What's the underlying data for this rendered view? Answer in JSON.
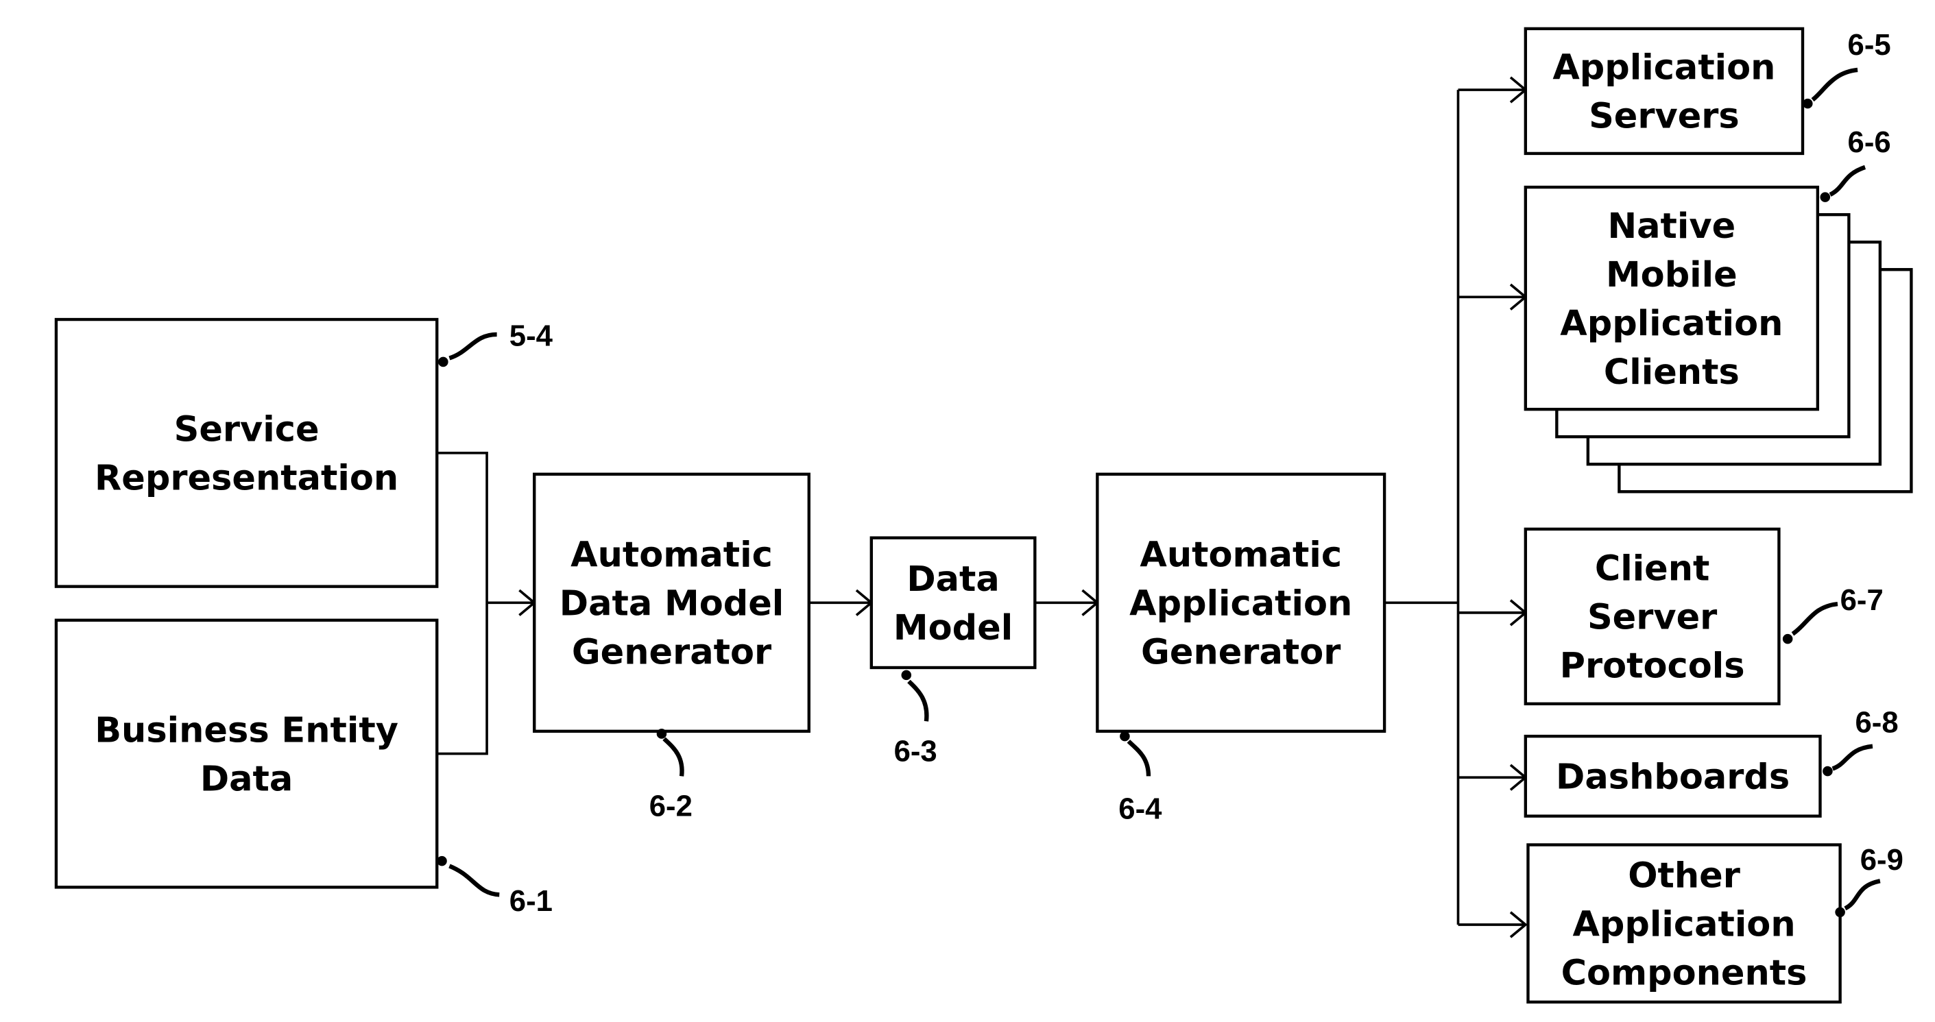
{
  "diagram": {
    "nodes": [
      {
        "id": "service-representation",
        "lines": [
          "Service",
          "Representation"
        ],
        "ref": "5-4"
      },
      {
        "id": "business-entity-data",
        "lines": [
          "Business Entity",
          "Data"
        ],
        "ref": "6-1"
      },
      {
        "id": "automatic-data-model-generator",
        "lines": [
          "Automatic",
          "Data Model",
          "Generator"
        ],
        "ref": "6-2"
      },
      {
        "id": "data-model",
        "lines": [
          "Data",
          "Model"
        ],
        "ref": "6-3"
      },
      {
        "id": "automatic-application-generator",
        "lines": [
          "Automatic",
          "Application",
          "Generator"
        ],
        "ref": "6-4"
      },
      {
        "id": "application-servers",
        "lines": [
          "Application",
          "Servers"
        ],
        "ref": "6-5"
      },
      {
        "id": "native-mobile-application-clients",
        "lines": [
          "Native",
          "Mobile",
          "Application",
          "Clients"
        ],
        "ref": "6-6"
      },
      {
        "id": "client-server-protocols",
        "lines": [
          "Client",
          "Server",
          "Protocols"
        ],
        "ref": "6-7"
      },
      {
        "id": "dashboards",
        "lines": [
          "Dashboards"
        ],
        "ref": "6-8"
      },
      {
        "id": "other-application-components",
        "lines": [
          "Other",
          "Application",
          "Components"
        ],
        "ref": "6-9"
      }
    ],
    "edges": [
      {
        "from": [
          "service-representation",
          "business-entity-data"
        ],
        "to": "automatic-data-model-generator"
      },
      {
        "from": "automatic-data-model-generator",
        "to": "data-model"
      },
      {
        "from": "data-model",
        "to": "automatic-application-generator"
      },
      {
        "from": "automatic-application-generator",
        "to": [
          "application-servers",
          "native-mobile-application-clients",
          "client-server-protocols",
          "dashboards",
          "other-application-components"
        ]
      }
    ]
  }
}
